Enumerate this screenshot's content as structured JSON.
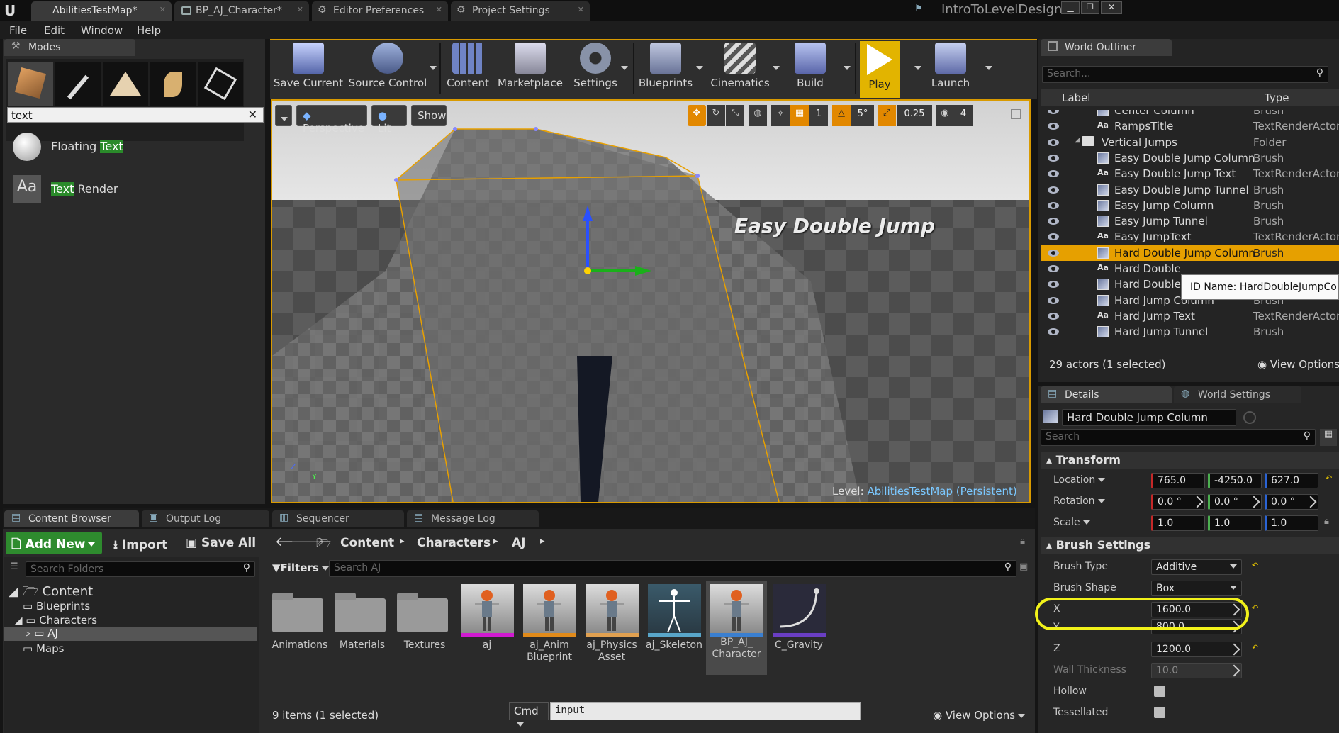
{
  "window": {
    "project": "IntroToLevelDesign",
    "tabs": [
      "AbilitiesTestMap*",
      "BP_AJ_Character*",
      "Editor Preferences",
      "Project Settings"
    ]
  },
  "menu": [
    "File",
    "Edit",
    "Window",
    "Help"
  ],
  "modes": {
    "title": "Modes",
    "search": "text",
    "results": [
      {
        "prefix": "Floating ",
        "match": "Text",
        "suffix": ""
      },
      {
        "prefix": "",
        "match": "Text",
        "suffix": " Render"
      }
    ]
  },
  "toolbar": [
    "Save Current",
    "Source Control",
    "Content",
    "Marketplace",
    "Settings",
    "Blueprints",
    "Cinematics",
    "Build",
    "Play",
    "Launch"
  ],
  "viewport": {
    "perspective": "Perspective",
    "lit": "Lit",
    "show": "Show",
    "snap_grid": "1",
    "snap_angle": "5°",
    "snap_scale": "0.25",
    "cam_speed": "4",
    "world_text": "Easy Double Jump",
    "level_label": "Level:",
    "level_name": "AbilitiesTestMap (Persistent)",
    "axis_z": "Z",
    "axis_y": "Y"
  },
  "outliner": {
    "title": "World Outliner",
    "search_placeholder": "Search...",
    "col_label": "Label",
    "col_type": "Type",
    "rows": [
      {
        "label": "Center Column",
        "type": "Brush",
        "icon": "brush"
      },
      {
        "label": "RampsTitle",
        "type": "TextRenderActor",
        "icon": "text"
      },
      {
        "label": "Vertical Jumps",
        "type": "Folder",
        "icon": "folder"
      },
      {
        "label": "Easy Double Jump Column",
        "type": "Brush",
        "icon": "brush"
      },
      {
        "label": "Easy Double Jump Text",
        "type": "TextRenderActor",
        "icon": "text"
      },
      {
        "label": "Easy Double Jump Tunnel",
        "type": "Brush",
        "icon": "brush"
      },
      {
        "label": "Easy Jump Column",
        "type": "Brush",
        "icon": "brush"
      },
      {
        "label": "Easy Jump Tunnel",
        "type": "Brush",
        "icon": "brush"
      },
      {
        "label": "Easy JumpText",
        "type": "TextRenderActor",
        "icon": "text"
      },
      {
        "label": "Hard Double Jump Column",
        "type": "Brush",
        "icon": "brush",
        "selected": true
      },
      {
        "label": "Hard Double",
        "type": "",
        "icon": "text"
      },
      {
        "label": "Hard Double",
        "type": "",
        "icon": "brush"
      },
      {
        "label": "Hard Jump Column",
        "type": "Brush",
        "icon": "brush"
      },
      {
        "label": "Hard Jump Text",
        "type": "TextRenderActor",
        "icon": "text"
      },
      {
        "label": "Hard Jump Tunnel",
        "type": "Brush",
        "icon": "brush"
      }
    ],
    "tooltip": "ID Name: HardDoubleJumpColumn",
    "status": "29 actors (1 selected)",
    "view_options": "View Options"
  },
  "details": {
    "tab": "Details",
    "tab2": "World Settings",
    "name": "Hard Double Jump Column",
    "search_placeholder": "Search",
    "transform": "Transform",
    "location_label": "Location",
    "rotation_label": "Rotation",
    "scale_label": "Scale",
    "location": [
      "765.0",
      "-4250.0",
      "627.0"
    ],
    "rotation": [
      "0.0 °",
      "0.0 °",
      "0.0 °"
    ],
    "scale": [
      "1.0",
      "1.0",
      "1.0"
    ],
    "brush_settings": "Brush Settings",
    "brush_type_label": "Brush Type",
    "brush_type": "Additive",
    "brush_shape_label": "Brush Shape",
    "brush_shape": "Box",
    "x_label": "X",
    "x": "1600.0",
    "y_label": "Y",
    "y": "800.0",
    "z_label": "Z",
    "z": "1200.0",
    "wall_label": "Wall Thickness",
    "wall": "10.0",
    "hollow_label": "Hollow",
    "tess_label": "Tessellated",
    "highlight_color": "#f2f21a"
  },
  "bottom_tabs": [
    "Content Browser",
    "Output Log",
    "Sequencer",
    "Message Log"
  ],
  "content": {
    "add_new": "Add New",
    "import": "Import",
    "save_all": "Save All",
    "path": [
      "Content",
      "Characters",
      "AJ"
    ],
    "search_folders": "Search Folders",
    "filters": "Filters",
    "search_placeholder": "Search AJ",
    "tree": [
      "Content",
      "Blueprints",
      "Characters",
      "AJ",
      "Maps"
    ],
    "assets": [
      {
        "name": "Animations",
        "kind": "folder"
      },
      {
        "name": "Materials",
        "kind": "folder"
      },
      {
        "name": "Textures",
        "kind": "folder"
      },
      {
        "name": "aj",
        "kind": "mesh",
        "color": "#d01ad0"
      },
      {
        "name": "aj_Anim Blueprint",
        "kind": "anim",
        "color": "#e08a1a"
      },
      {
        "name": "aj_Physics Asset",
        "kind": "phys",
        "color": "#e0a050"
      },
      {
        "name": "aj_Skeleton",
        "kind": "skel",
        "color": "#59a6c9"
      },
      {
        "name": "BP_AJ_ Character",
        "kind": "bp",
        "color": "#3a7fd0"
      },
      {
        "name": "C_Gravity",
        "kind": "curve",
        "color": "#6a3ec4"
      }
    ],
    "status": "9 items (1 selected)",
    "view_options": "View Options",
    "cmd": "Cmd",
    "cmd_input": "input"
  }
}
